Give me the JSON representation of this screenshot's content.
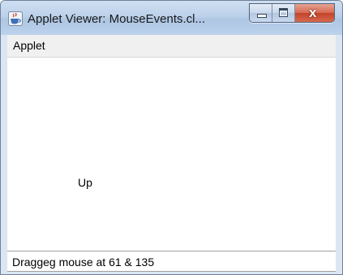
{
  "window": {
    "title": "Applet Viewer: MouseEvents.cl...",
    "icon": "java-cup-icon"
  },
  "caption_buttons": {
    "minimize_icon": "minimize-icon",
    "maximize_icon": "maximize-icon",
    "close_glyph": "x"
  },
  "menubar": {
    "items": [
      {
        "label": "Applet"
      }
    ]
  },
  "applet": {
    "drawn_message": "Up"
  },
  "status": {
    "text": "Draggeg mouse at 61 & 135"
  },
  "colors": {
    "titlebar": "#bcd1ea",
    "close_button": "#c2432a",
    "menubar": "#f0f0f0",
    "content": "#ffffff"
  }
}
